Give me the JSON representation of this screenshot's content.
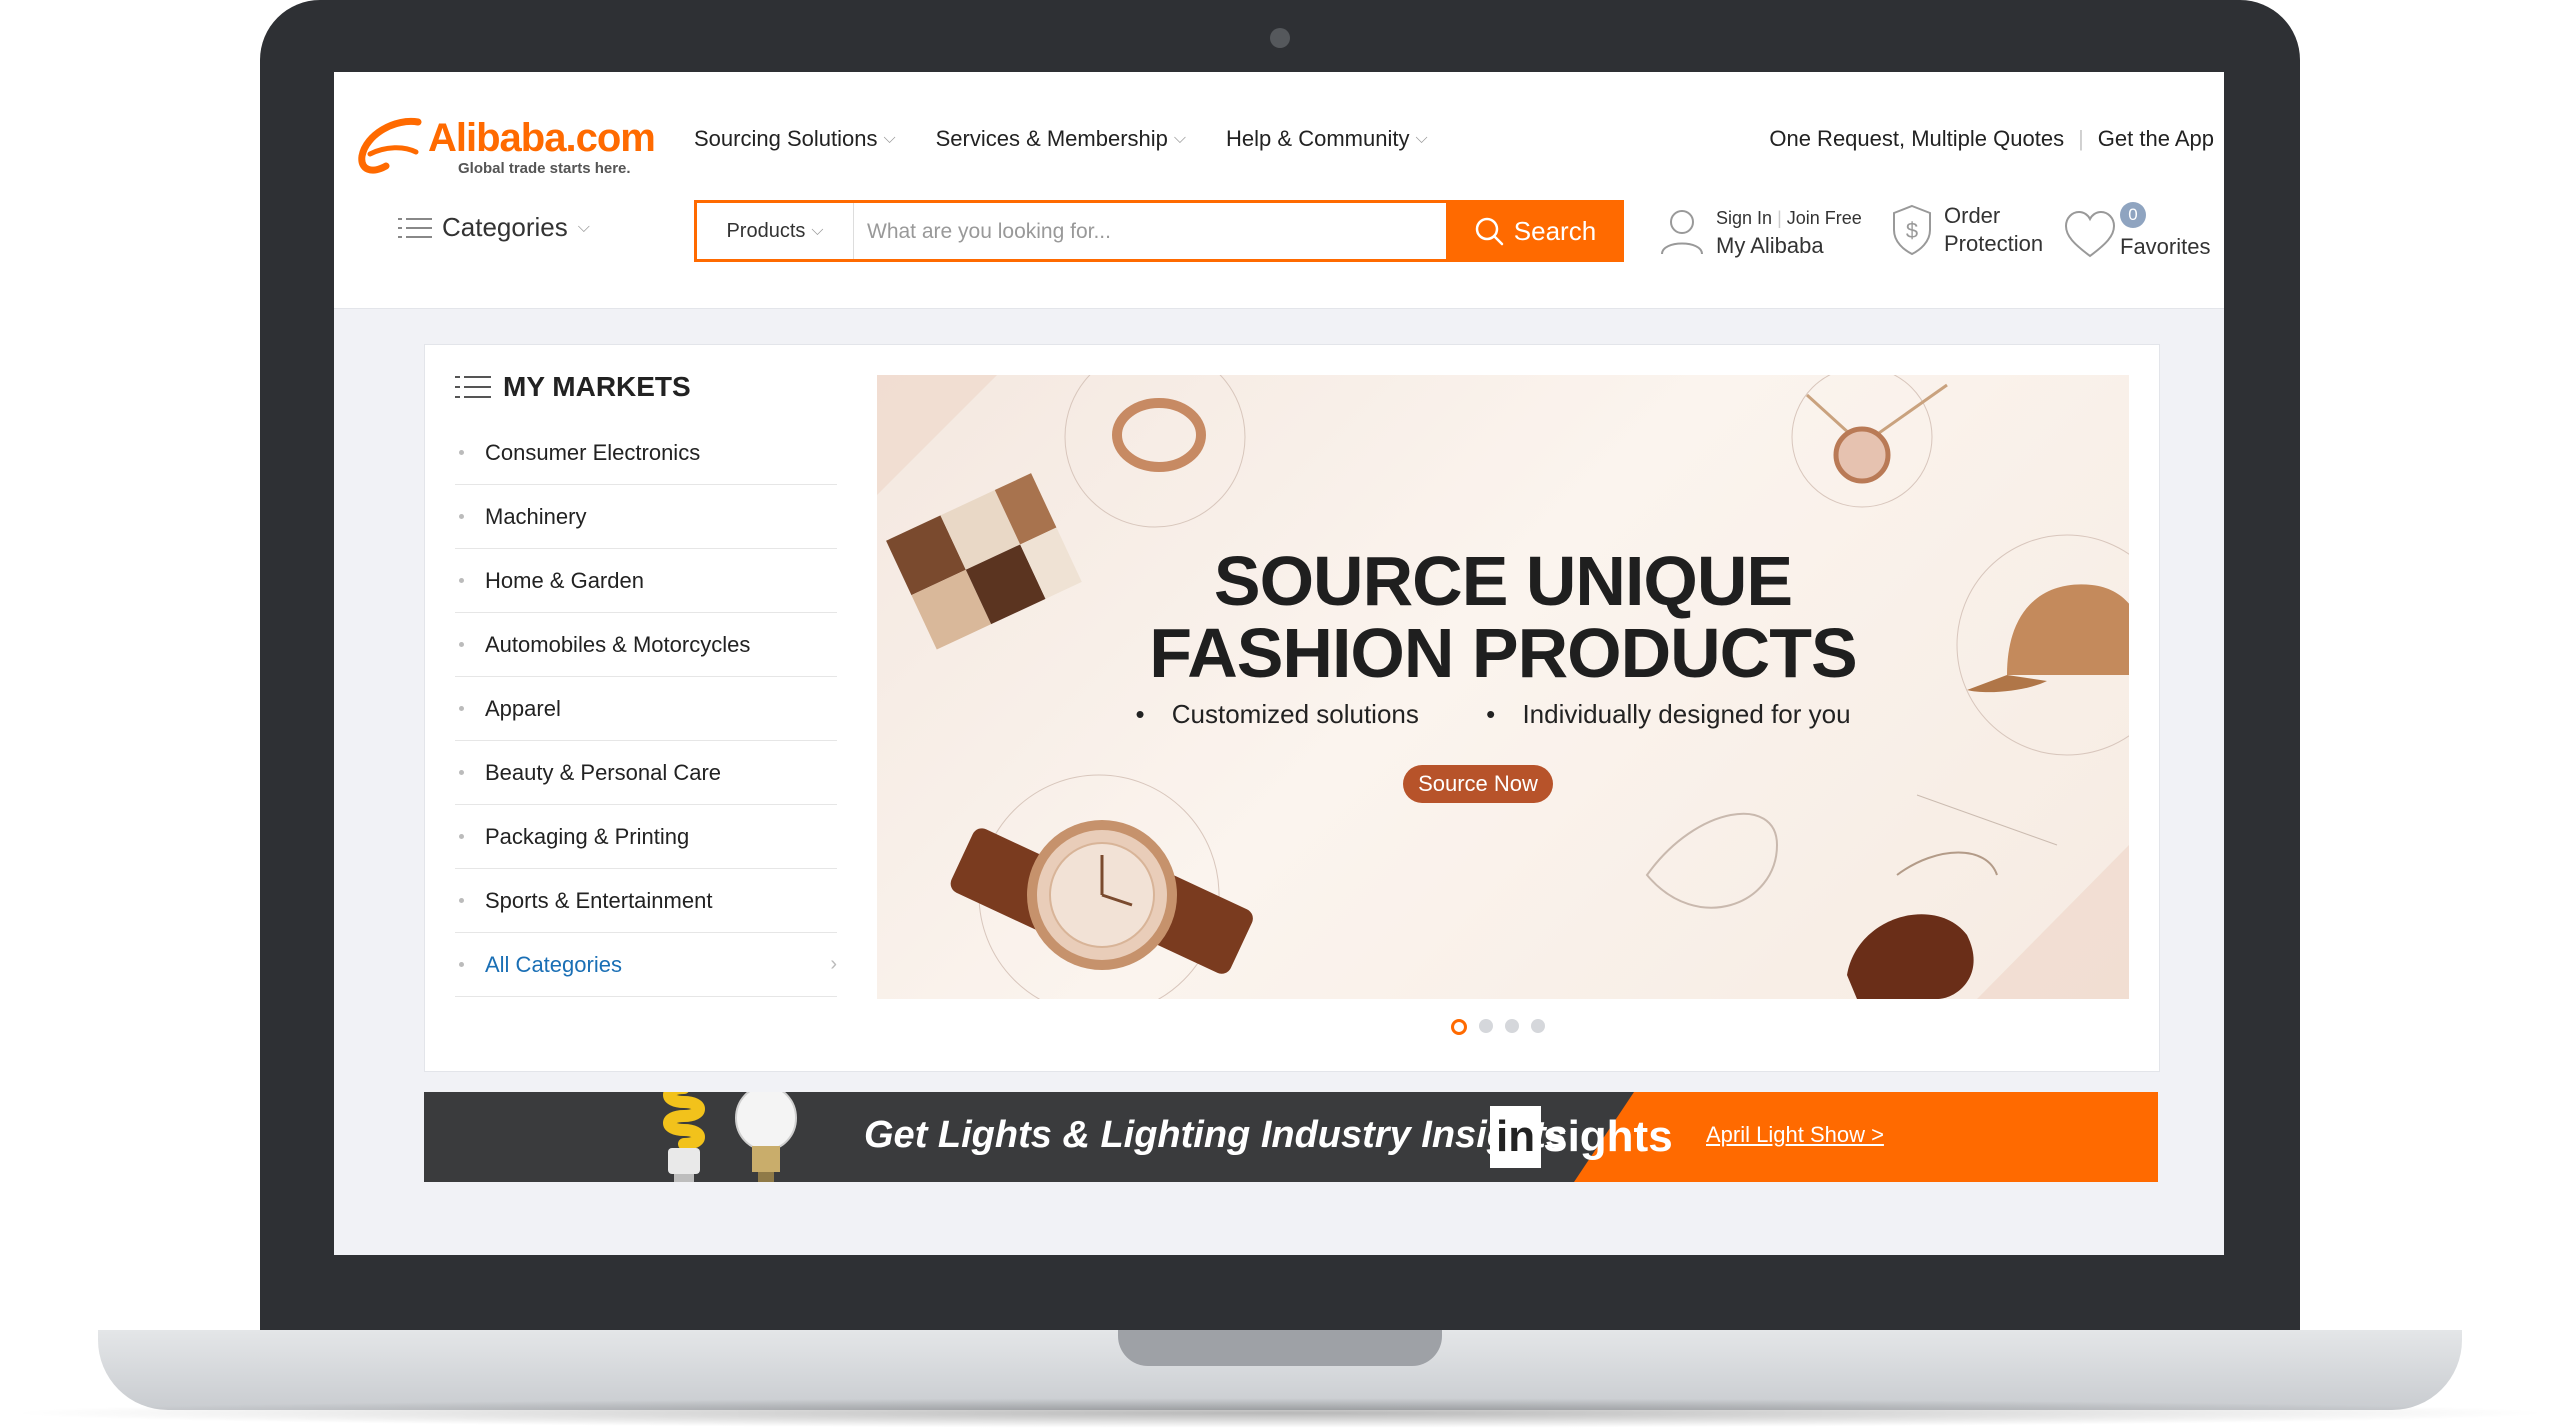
{
  "header": {
    "logo_text": "Alibaba.com",
    "logo_tagline": "Global trade starts here.",
    "nav": [
      {
        "label": "Sourcing Solutions"
      },
      {
        "label": "Services & Membership"
      },
      {
        "label": "Help & Community"
      }
    ],
    "links": {
      "quotes": "One Request, Multiple Quotes",
      "app": "Get the App"
    },
    "categories_label": "Categories",
    "search": {
      "type_label": "Products",
      "placeholder": "What are you looking for...",
      "button_label": "Search"
    },
    "account": {
      "sign_in": "Sign In",
      "join_free": "Join Free",
      "my_alibaba": "My Alibaba"
    },
    "order_protection": [
      "Order",
      "Protection"
    ],
    "favorites": {
      "count": "0",
      "label": "Favorites"
    }
  },
  "markets": {
    "title": "MY MARKETS",
    "items": [
      "Consumer Electronics",
      "Machinery",
      "Home & Garden",
      "Automobiles & Motorcycles",
      "Apparel",
      "Beauty & Personal Care",
      "Packaging & Printing",
      "Sports & Entertainment"
    ],
    "all_label": "All Categories"
  },
  "banner": {
    "line1": "SOURCE UNIQUE",
    "line2": "FASHION PRODUCTS",
    "bullets": [
      "Customized solutions",
      "Individually designed for you"
    ],
    "cta": "Source Now",
    "slides": 4,
    "active_slide": 1
  },
  "promo": {
    "text": "Get Lights & Lighting Industry Insights",
    "brand_in": "in",
    "brand_rest": "sights",
    "link": "April Light Show >"
  },
  "colors": {
    "accent": "#ff6a00",
    "link": "#1a6fb5",
    "cta": "#b7532a"
  }
}
